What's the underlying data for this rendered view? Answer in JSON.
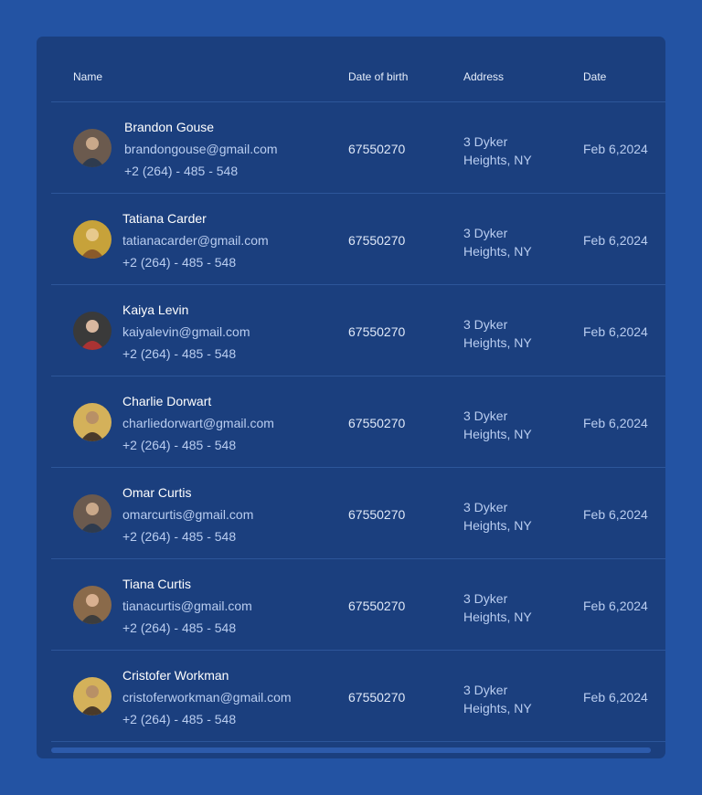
{
  "table": {
    "columns": {
      "name": "Name",
      "dob": "Date of birth",
      "address": "Address",
      "date": "Date"
    },
    "rows": [
      {
        "name": "Brandon Gouse",
        "email": "brandongouse@gmail.com",
        "phone": "+2 (264) - 485 - 548",
        "dob": "67550270",
        "address_line1": "3 Dyker",
        "address_line2": "Heights, NY",
        "date": "Feb 6,2024"
      },
      {
        "name": "Tatiana Carder",
        "email": "tatianacarder@gmail.com",
        "phone": "+2 (264) - 485 - 548",
        "dob": "67550270",
        "address_line1": "3 Dyker",
        "address_line2": "Heights, NY",
        "date": "Feb 6,2024"
      },
      {
        "name": "Kaiya Levin",
        "email": "kaiyalevin@gmail.com",
        "phone": "+2 (264) - 485 - 548",
        "dob": "67550270",
        "address_line1": "3 Dyker",
        "address_line2": "Heights, NY",
        "date": "Feb 6,2024"
      },
      {
        "name": "Charlie Dorwart",
        "email": "charliedorwart@gmail.com",
        "phone": "+2 (264) - 485 - 548",
        "dob": "67550270",
        "address_line1": "3 Dyker",
        "address_line2": "Heights, NY",
        "date": "Feb 6,2024"
      },
      {
        "name": "Omar Curtis",
        "email": "omarcurtis@gmail.com",
        "phone": "+2 (264) - 485 - 548",
        "dob": "67550270",
        "address_line1": "3 Dyker",
        "address_line2": "Heights, NY",
        "date": "Feb 6,2024"
      },
      {
        "name": "Tiana Curtis",
        "email": "tianacurtis@gmail.com",
        "phone": "+2 (264) - 485 - 548",
        "dob": "67550270",
        "address_line1": "3 Dyker",
        "address_line2": "Heights, NY",
        "date": "Feb 6,2024"
      },
      {
        "name": "Cristofer Workman",
        "email": "cristoferworkman@gmail.com",
        "phone": "+2 (264) - 485 - 548",
        "dob": "67550270",
        "address_line1": "3 Dyker",
        "address_line2": "Heights, NY",
        "date": "Feb 6,2024"
      }
    ]
  },
  "colors": {
    "page_background": "#2353a3",
    "card_background": "#1b3f7e",
    "divider": "#2d569a",
    "primary_text": "#ffffff",
    "secondary_text": "#b9cdf0"
  },
  "icons": {
    "avatar": "user-photo-icon"
  }
}
